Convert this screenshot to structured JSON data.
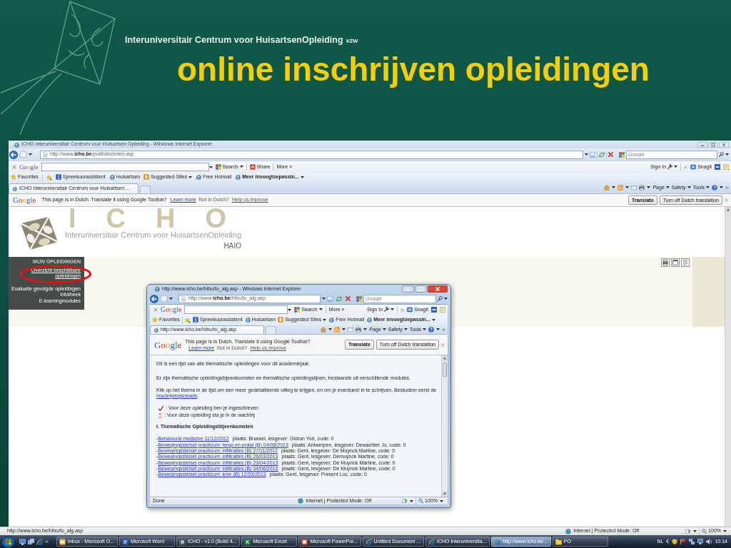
{
  "slide": {
    "organization": "Interuniversitair Centrum voor HuisartsenOpleiding",
    "organization_suffix": "vzw",
    "title": "online inschrijven opleidingen"
  },
  "browser": {
    "title": "ICHO Interuniversitair Centrum voor Huisartsen Opleiding - Windows Internet Explorer",
    "address": "http://www.**icho.be**/portfolio/index.asp",
    "search_placeholder": "Google",
    "google_toolbar": {
      "logo": "Google",
      "items": [
        {
          "kind": "search",
          "label": "Search",
          "dropdown": true
        },
        {
          "kind": "share",
          "label": "Share",
          "dropdown": false
        },
        {
          "kind": "more",
          "label": "More »",
          "dropdown": false
        }
      ],
      "right_items": [
        {
          "kind": "sign-in",
          "label": "Sign In",
          "dropdown": true
        },
        {
          "kind": "snagit",
          "label": "Snagit",
          "dropdown": false
        }
      ]
    },
    "favorites": {
      "label": "Favorites",
      "links": [
        {
          "kind": "s-site",
          "label": "Spreekuurassistent",
          "dropdown": false
        },
        {
          "kind": "ie-site",
          "label": "Huisartsen",
          "dropdown": false
        },
        {
          "kind": "suggested",
          "label": "Suggested Sites",
          "dropdown": true
        },
        {
          "kind": "ie-site",
          "label": "Free Hotmail",
          "dropdown": false
        },
        {
          "kind": "add-ons",
          "label": "Meer invoegtoepassin...",
          "dropdown": true
        }
      ]
    },
    "tabs": [
      {
        "title": "ICHO Interuniversitair Centrum voor Huisartsen ...",
        "selected": true
      }
    ],
    "command_bar": [
      {
        "kind": "home",
        "dropdown": true
      },
      {
        "kind": "feeds",
        "dropdown": true
      },
      {
        "kind": "mail",
        "dropdown": false
      },
      {
        "kind": "print",
        "dropdown": true
      },
      {
        "kind": "menu",
        "label": "Page",
        "dropdown": true
      },
      {
        "kind": "menu",
        "label": "Safety",
        "dropdown": true
      },
      {
        "kind": "menu",
        "label": "Tools",
        "dropdown": true
      },
      {
        "kind": "help",
        "dropdown": true
      }
    ],
    "translate_bar": {
      "logo": "Google",
      "message": "This page is in Dutch.  Translate it using Google Toolbar?",
      "learn_more": "Learn more",
      "not_dutch": "Not in Dutch?",
      "improve": "Help us improve",
      "buttons": [
        "Translate",
        "Turn off Dutch translation"
      ]
    },
    "page": {
      "background_logo": "ICHO",
      "organization": "Interuniversitair Centrum voor HuisartsenOpleiding",
      "subtitle": "HAIO",
      "sidebar": {
        "heading": "MIJN OPLEIDINGEN",
        "items": [
          {
            "label": "Overzicht beschikbare opleidingen",
            "selected": true
          },
          {
            "label": "Evaluatie gevolgde opleidingen",
            "selected": false
          },
          {
            "label": "Infotheek",
            "selected": false
          },
          {
            "label": "E-learningmodules",
            "selected": false
          }
        ]
      }
    },
    "status_bar": {
      "url": "http://www.icho.be/hibo/to_alg.asp",
      "zone": "Internet | Protected Mode: Off",
      "zoom": "100%"
    }
  },
  "popup": {
    "title": "http://www.icho.be/hibo/to_alg.asp - Windows Internet Explorer",
    "address": "http://www.**icho.be**/hibo/to_alg.asp",
    "search_placeholder": "Google",
    "google_toolbar": {
      "logo": "Google",
      "items": [
        {
          "kind": "search",
          "label": "Search",
          "dropdown": true
        },
        {
          "kind": "more",
          "label": "More »",
          "dropdown": false
        }
      ],
      "right_items": [
        {
          "kind": "sign-in",
          "label": "Sign In",
          "dropdown": true
        },
        {
          "kind": "snagit",
          "label": "Snagit",
          "dropdown": false
        }
      ]
    },
    "favorites": {
      "label": "Favorites",
      "links": [
        {
          "kind": "s-site",
          "label": "Spreekuurassistent",
          "dropdown": false
        },
        {
          "kind": "ie-site",
          "label": "Huisartsen",
          "dropdown": false
        },
        {
          "kind": "suggested",
          "label": "Suggested Sites",
          "dropdown": true
        },
        {
          "kind": "ie-site",
          "label": "Free Hotmail",
          "dropdown": false
        },
        {
          "kind": "add-ons",
          "label": "Meer invoegtoepassin...",
          "dropdown": true
        }
      ]
    },
    "tabs": [
      {
        "title": "http://www.icho.be/hibo/to_alg.asp",
        "selected": true
      }
    ],
    "command_bar": [
      {
        "kind": "home",
        "dropdown": true
      },
      {
        "kind": "feeds",
        "dropdown": true
      },
      {
        "kind": "mail",
        "dropdown": false
      },
      {
        "kind": "print",
        "dropdown": true
      },
      {
        "kind": "menu",
        "label": "Page",
        "dropdown": true
      },
      {
        "kind": "menu",
        "label": "Safety",
        "dropdown": true
      },
      {
        "kind": "menu",
        "label": "Tools",
        "dropdown": true
      },
      {
        "kind": "help",
        "dropdown": true
      }
    ],
    "translate_bar": {
      "logo": "Google",
      "message": "This page is in Dutch.  Translate it using Google Toolbar?",
      "learn_more": "Learn more",
      "not_dutch": "Not in Dutch?",
      "improve": "Help us improve",
      "buttons": [
        "Translate",
        "Turn off Dutch translation"
      ]
    },
    "content": {
      "intro": "Dit is een lijst van alle thematische opleidingen voor dit academiejaar.",
      "description": "Er zijn thematische opleidingsbijeenkomsten en thematische opleidingslijnen, bestaande uit verschillende modules.",
      "instructions": {
        "text": "Klik op het thema in de lijst om een meer gedetailleerde uitleg te krijgen, en om je eventueel in te schrijven. Bestudeer eerst de ",
        "link": "inschrijvingsregels",
        "after": "."
      },
      "legend": [
        {
          "kind": "enrolled",
          "text": ": Voor deze opleiding ben je ingeschreven"
        },
        {
          "kind": "waiting",
          "text": ": Voor deze opleiding sta je in de wachtrij"
        }
      ],
      "heading": "I. Thematische Opleidingsbijeenkomsten",
      "courses": [
        {
          "marker": "-",
          "title": "Behavioral medicine 11/12/2012",
          "details": "plaats: Brussel, lesgever: Gidron Yori, code: 0"
        },
        {
          "marker": "-",
          "title": "Bewegingsstelsel practicum: heup en enkel (B) 04/06/2013",
          "details": "plaats: Antwerpen, lesgever: Dewachter Jo, code: 0"
        },
        {
          "marker": "-",
          "title": "Bewegingsstelsel practicum: infiltraties (B) 27/11/2012",
          "details": "plaats: Gent, lesgever: De Muynck Martine, code: 0"
        },
        {
          "marker": "-",
          "title": "Bewegingsstelsel practicum: infiltraties (B) 26/03/2013",
          "details": "plaats: Gent, lesgever: Demuynck Martine, code: 0"
        },
        {
          "marker": "-",
          "title": "Bewegingsstelsel practicum: infiltraties (B) 23/04/2013",
          "details": "plaats: Gent, lesgever: De Muynck Martine, code: 0"
        },
        {
          "marker": "-",
          "title": "Bewegingsstelsel practicum: infiltraties (B) 04/06/2013",
          "details": "plaats: Gent, lesgever: De Muynck Martine, code: 0"
        },
        {
          "marker": "-",
          "title": "Bewegingsstelsel practicum: knie (B) 12/03/2013",
          "details": "plaats: Gent, lesgever: Present Luc, code: 0"
        }
      ]
    },
    "status_bar": {
      "text": "Done",
      "zone": "Internet | Protected Mode: Off",
      "zoom": "100%"
    }
  },
  "taskbar": {
    "buttons": [
      {
        "kind": "outlook",
        "label": "Inbox - Microsoft O...",
        "selected": false
      },
      {
        "kind": "word",
        "label": "Microsoft Word",
        "selected": false
      },
      {
        "kind": "app",
        "label": "ICHO - v1.0 (Build 4...",
        "selected": false
      },
      {
        "kind": "excel",
        "label": "Microsoft Excel",
        "selected": false
      },
      {
        "kind": "powerpoint",
        "label": "Microsoft PowerPoi...",
        "selected": false
      },
      {
        "kind": "ie",
        "label": "Untitled Document ...",
        "selected": false
      },
      {
        "kind": "ie",
        "label": "ICHO Interuniversita...",
        "selected": false
      },
      {
        "kind": "ie",
        "label": "http://www.icho.be...",
        "selected": true
      },
      {
        "kind": "folder",
        "label": "PO",
        "selected": false
      }
    ],
    "language": "NL",
    "clock": "10:14"
  }
}
